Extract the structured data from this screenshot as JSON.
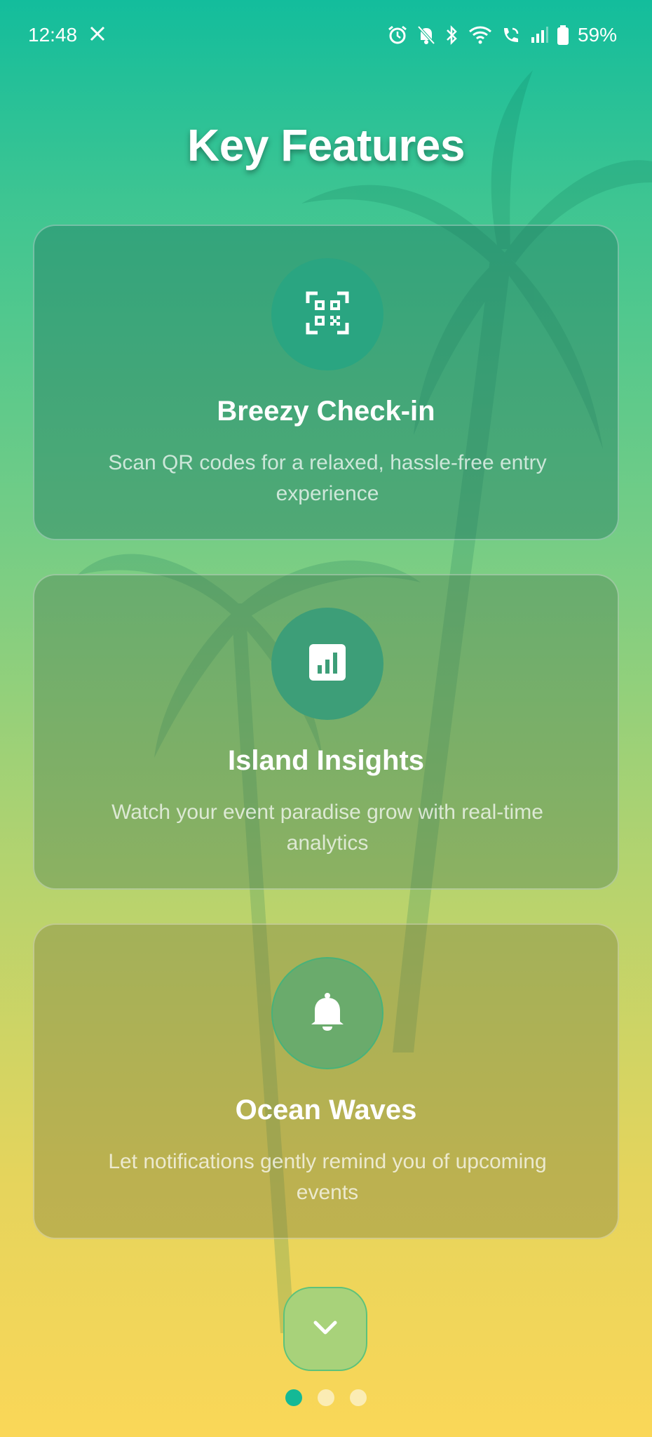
{
  "status_bar": {
    "time": "12:48",
    "notification_icon": "x-logo-icon",
    "battery": "59%",
    "icons": [
      "alarm-icon",
      "mute-icon",
      "bluetooth-icon",
      "wifi-icon",
      "wifi-call-icon",
      "signal-icon",
      "battery-icon"
    ]
  },
  "page": {
    "title": "Key Features"
  },
  "features": [
    {
      "icon": "qr-code-icon",
      "title": "Breezy Check-in",
      "description": "Scan QR codes for a relaxed, hassle-free entry experience"
    },
    {
      "icon": "analytics-chart-icon",
      "title": "Island Insights",
      "description": "Watch your event paradise grow with real-time analytics"
    },
    {
      "icon": "bell-icon",
      "title": "Ocean Waves",
      "description": "Let notifications gently remind you of upcoming events"
    }
  ],
  "navigation": {
    "next_icon": "chevron-down-icon",
    "page_indicator": {
      "total": 3,
      "active": 1
    }
  },
  "colors": {
    "gradient_top": "#13bd9c",
    "gradient_bottom": "#fad758",
    "active_dot": "#14b996"
  }
}
